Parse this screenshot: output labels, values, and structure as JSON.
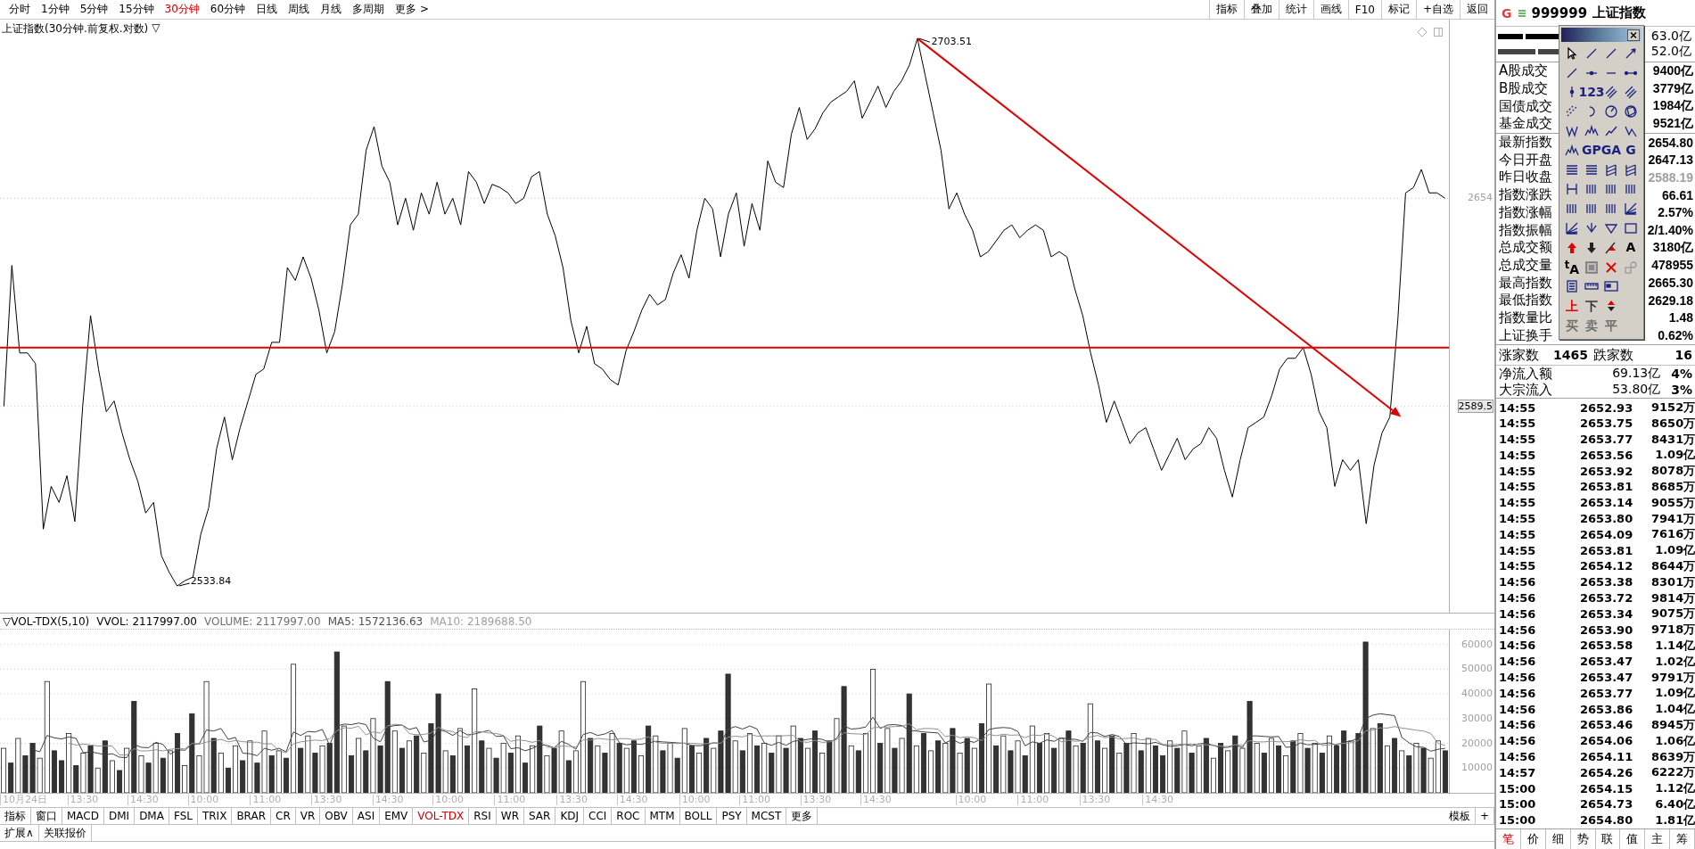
{
  "toolbar": {
    "periods": [
      {
        "label": "分时",
        "selected": false
      },
      {
        "label": "1分钟",
        "selected": false
      },
      {
        "label": "5分钟",
        "selected": false
      },
      {
        "label": "15分钟",
        "selected": false
      },
      {
        "label": "30分钟",
        "selected": true
      },
      {
        "label": "60分钟",
        "selected": false
      },
      {
        "label": "日线",
        "selected": false
      },
      {
        "label": "周线",
        "selected": false
      },
      {
        "label": "月线",
        "selected": false
      },
      {
        "label": "多周期",
        "selected": false
      },
      {
        "label": "更多 >",
        "selected": false
      }
    ],
    "buttons": [
      "指标",
      "叠加",
      "统计",
      "画线",
      "F10",
      "标记",
      "+自选",
      "返回"
    ]
  },
  "main_chart": {
    "title": "上证指数(30分钟.前复权.对数)",
    "title_menu": "▽",
    "high_label": "2703.51",
    "low_label": "2533.84",
    "chart_data": {
      "type": "line",
      "grid": true,
      "ylim": [
        2525.6,
        2709.3
      ],
      "categories": [
        null,
        null,
        null,
        null,
        null,
        null,
        null,
        null,
        null,
        null,
        null,
        null,
        null,
        null,
        null,
        null,
        null,
        null,
        null,
        null,
        null,
        null,
        null,
        null,
        null,
        null,
        null,
        null,
        null,
        null,
        null,
        null,
        null,
        null,
        null,
        null,
        null,
        null,
        null,
        null,
        null,
        null,
        null,
        null,
        null,
        null,
        null,
        null,
        null,
        null,
        null,
        null,
        null,
        null,
        null,
        null,
        null,
        null,
        null,
        null,
        null,
        null,
        null,
        null,
        null,
        null,
        null,
        null,
        null,
        null,
        null,
        null,
        null,
        null,
        null,
        null,
        null,
        null,
        null,
        null,
        null,
        null,
        null,
        null,
        null,
        null,
        null,
        null,
        null,
        null,
        null,
        null,
        null,
        null,
        null,
        null,
        null,
        null,
        null,
        null,
        null,
        null,
        null,
        null,
        null,
        null,
        null,
        null,
        null,
        null,
        null,
        null,
        null,
        null,
        null,
        null,
        null,
        null,
        null,
        null,
        null,
        null,
        null,
        null,
        null,
        null,
        null,
        null,
        null,
        null,
        null,
        null,
        null,
        null,
        null,
        null,
        null,
        null,
        null,
        null,
        null,
        null,
        null,
        null,
        null,
        null,
        null,
        null,
        null,
        null,
        null,
        null,
        null,
        null,
        null,
        null,
        null,
        null,
        null,
        null,
        null,
        null,
        null,
        null,
        null,
        null,
        null,
        null,
        null,
        null,
        null,
        null,
        null,
        null,
        null,
        null,
        null,
        null,
        null,
        null,
        null,
        null,
        null,
        null
      ],
      "yticks": [
        {
          "value": 2654,
          "label": "2654"
        },
        {
          "value": 2589.5,
          "label": "2589.5"
        }
      ],
      "series": [
        {
          "color": "#000000",
          "values": [
            2589.5,
            2633.16,
            2606.04,
            2606.04,
            2602.73,
            2551.45,
            2564.69,
            2559.72,
            2567.99,
            2553.77,
            2589.5,
            2617.61,
            2601.07,
            2587.84,
            2591.15,
            2581.23,
            2572.96,
            2566.34,
            2556.42,
            2559.72,
            2543.18,
            2538.0,
            2533.84,
            2535.5,
            2536.57,
            2549.8,
            2558.07,
            2576.26,
            2586.19,
            2572.96,
            2582.88,
            2591.15,
            2599.42,
            2601.07,
            2609.34,
            2609.34,
            2632.5,
            2628.53,
            2635.81,
            2629.19,
            2619.27,
            2606.04,
            2612.65,
            2627.54,
            2645.73,
            2649.04,
            2668.89,
            2676.17,
            2663.93,
            2658.96,
            2645.73,
            2654.0,
            2644.08,
            2655.66,
            2649.04,
            2658.96,
            2649.04,
            2654.0,
            2645.73,
            2662.27,
            2658.96,
            2652.35,
            2658.3,
            2657.31,
            2655.66,
            2652.35,
            2654.0,
            2660.62,
            2662.27,
            2649.04,
            2642.42,
            2632.5,
            2615.96,
            2606.04,
            2614.31,
            2602.73,
            2601.07,
            2597.77,
            2596.11,
            2606.7,
            2612.65,
            2619.27,
            2624.23,
            2620.92,
            2622.58,
            2630.85,
            2636.47,
            2629.19,
            2644.08,
            2654.0,
            2650.69,
            2635.81,
            2649.04,
            2655.66,
            2639.12,
            2652.35,
            2644.08,
            2665.58,
            2658.96,
            2657.31,
            2673.85,
            2682.12,
            2672.2,
            2675.5,
            2680.47,
            2683.77,
            2685.43,
            2687.08,
            2690.39,
            2678.81,
            2683.77,
            2688.74,
            2682.12,
            2687.08,
            2690.39,
            2695.35,
            2703.51,
            2692.04,
            2680.47,
            2668.89,
            2650.69,
            2655.66,
            2649.04,
            2644.08,
            2635.81,
            2637.46,
            2640.77,
            2644.08,
            2645.73,
            2641.76,
            2644.08,
            2645.73,
            2644.08,
            2635.81,
            2637.46,
            2635.81,
            2625.88,
            2617.61,
            2606.04,
            2596.11,
            2584.53,
            2591.15,
            2584.53,
            2577.92,
            2581.23,
            2582.88,
            2576.26,
            2569.65,
            2574.61,
            2579.57,
            2572.96,
            2576.26,
            2577.92,
            2582.88,
            2579.57,
            2569.65,
            2561.38,
            2572.96,
            2582.88,
            2584.53,
            2586.19,
            2592.8,
            2601.07,
            2604.38,
            2604.38,
            2607.69,
            2599.42,
            2587.84,
            2582.88,
            2564.69,
            2572.96,
            2569.65,
            2572.96,
            2553.11,
            2571.3,
            2581.23,
            2586.19,
            2615.96,
            2655.66,
            2657.31,
            2662.93,
            2655.66,
            2655.66,
            2654.0
          ]
        }
      ],
      "ref_lines": [
        {
          "axis": "y",
          "value": 2607.7,
          "color": "#e00000"
        }
      ]
    },
    "drawings": [
      {
        "kind": "arrow",
        "color": "#e00000"
      }
    ]
  },
  "time_axis": [
    "10月24日",
    "13:30",
    "14:30",
    "10:00",
    "11:00",
    "13:30",
    "14:30",
    "10:00",
    "11:00",
    "13:30",
    "14:30",
    "10:00",
    "11:00",
    "13:30",
    "14:30",
    "10:00",
    "11:00",
    "13:30",
    "14:30"
  ],
  "volume_panel": {
    "header": [
      {
        "text": "▽VOL-TDX(5,10)",
        "color": "#000000"
      },
      {
        "text": "VVOL: 2117997.00",
        "color": "#000000"
      },
      {
        "text": "VOLUME: 2117997.00",
        "color": "#707070"
      },
      {
        "text": "MA5: 1572136.63",
        "color": "#505050"
      },
      {
        "text": "MA10: 2189688.50",
        "color": "#a0a0a0"
      }
    ],
    "chart_data": {
      "type": "bar",
      "stacked": true,
      "grid": true,
      "ylim": [
        0,
        66000
      ],
      "yticks": [
        10000,
        20000,
        30000,
        40000,
        50000,
        60000
      ],
      "series": [
        {
          "color": "#ffffff",
          "values": [
            18000,
            null,
            22000,
            null,
            null,
            14000,
            45000,
            null,
            null,
            24000,
            null,
            16000,
            null,
            10000,
            null,
            13000,
            null,
            18000,
            null,
            15000,
            null,
            20000,
            null,
            17000,
            null,
            11000,
            null,
            15000,
            45000,
            null,
            16000,
            null,
            19000,
            null,
            21000,
            null,
            25000,
            null,
            17000,
            null,
            52000,
            null,
            23000,
            null,
            19000,
            null,
            null,
            27000,
            null,
            22000,
            null,
            30000,
            null,
            null,
            25000,
            null,
            21000,
            null,
            16000,
            null,
            null,
            17000,
            null,
            26000,
            null,
            42000,
            null,
            18000,
            null,
            20000,
            null,
            23000,
            null,
            19000,
            null,
            15000,
            null,
            25000,
            null,
            17000,
            45000,
            null,
            19000,
            null,
            24000,
            null,
            18000,
            null,
            15000,
            null,
            23000,
            null,
            20000,
            null,
            26000,
            null,
            16000,
            null,
            18000,
            null,
            null,
            21000,
            null,
            24000,
            null,
            20000,
            null,
            23000,
            null,
            27000,
            null,
            18000,
            null,
            16000,
            null,
            30000,
            null,
            19000,
            null,
            24000,
            50000,
            null,
            26000,
            null,
            22000,
            null,
            19000,
            null,
            17000,
            null,
            20000,
            null,
            16000,
            null,
            18000,
            null,
            44000,
            null,
            23000,
            null,
            21000,
            null,
            27000,
            null,
            24000,
            null,
            22000,
            null,
            19000,
            null,
            36000,
            null,
            18000,
            null,
            16000,
            null,
            24000,
            null,
            22000,
            null,
            null,
            21000,
            null,
            25000,
            null,
            19000,
            null,
            14000,
            null,
            17000,
            null,
            18000,
            null,
            20000,
            null,
            22000,
            null,
            15000,
            null,
            24000,
            null,
            20000,
            null,
            23000,
            null,
            null,
            21000,
            null,
            null,
            26000,
            null,
            19000,
            null,
            17000,
            null,
            20000,
            null,
            14000,
            21000,
            null
          ]
        },
        {
          "color": "#333333",
          "values": [
            null,
            12000,
            null,
            15000,
            20000,
            null,
            null,
            17000,
            13000,
            null,
            11000,
            null,
            19000,
            null,
            21000,
            null,
            9000,
            null,
            37000,
            null,
            12000,
            null,
            14000,
            null,
            24000,
            null,
            32000,
            null,
            null,
            22000,
            null,
            10000,
            null,
            13000,
            null,
            12000,
            null,
            15000,
            null,
            14000,
            null,
            18000,
            null,
            16000,
            null,
            20000,
            57000,
            null,
            15000,
            null,
            17000,
            null,
            19000,
            45000,
            null,
            18000,
            null,
            23000,
            null,
            28000,
            40000,
            null,
            15000,
            null,
            19000,
            null,
            21000,
            null,
            14000,
            null,
            16000,
            null,
            12000,
            null,
            27000,
            null,
            18000,
            null,
            13000,
            null,
            null,
            22000,
            null,
            16000,
            null,
            20000,
            null,
            21000,
            null,
            27000,
            null,
            17000,
            null,
            14000,
            null,
            19000,
            null,
            22000,
            null,
            25000,
            48000,
            null,
            17000,
            null,
            19000,
            null,
            16000,
            null,
            18000,
            null,
            22000,
            null,
            25000,
            null,
            21000,
            null,
            43000,
            null,
            17000,
            null,
            null,
            20000,
            null,
            18000,
            null,
            40000,
            null,
            24000,
            null,
            21000,
            null,
            26000,
            null,
            22000,
            null,
            28000,
            null,
            19000,
            null,
            17000,
            null,
            15000,
            null,
            20000,
            null,
            18000,
            null,
            25000,
            null,
            20000,
            null,
            21000,
            null,
            23000,
            null,
            20000,
            null,
            17000,
            null,
            19000,
            15000,
            null,
            18000,
            null,
            16000,
            null,
            22000,
            null,
            20000,
            null,
            23000,
            null,
            37000,
            null,
            16000,
            null,
            19000,
            null,
            21000,
            null,
            18000,
            null,
            16000,
            null,
            19000,
            25000,
            null,
            24000,
            61000,
            null,
            28000,
            null,
            22000,
            null,
            15000,
            null,
            18000,
            null,
            null,
            17000
          ]
        },
        {
          "type": "line",
          "color": "#404040",
          "values": [
            null,
            null,
            null,
            null,
            17400,
            16600,
            23200,
            22200,
            21800,
            22600,
            22000,
            16200,
            16600,
            16000,
            15400,
            15800,
            14400,
            14200,
            19600,
            18400,
            18200,
            20400,
            19600,
            15600,
            17400,
            17200,
            19600,
            19800,
            25400,
            25000,
            26000,
            21600,
            22400,
            16000,
            15800,
            15000,
            18000,
            17200,
            18000,
            16600,
            24600,
            23200,
            24800,
            24600,
            25600,
            19200,
            27000,
            27800,
            27600,
            28200,
            27600,
            22200,
            20600,
            26600,
            27200,
            27400,
            25600,
            26400,
            20600,
            21200,
            25600,
            24800,
            23200,
            25200,
            23400,
            23800,
            24600,
            25200,
            22800,
            23000,
            17800,
            18200,
            17000,
            18000,
            19400,
            19200,
            18200,
            20800,
            19600,
            17600,
            23600,
            24400,
            23200,
            23800,
            25200,
            20200,
            19400,
            19800,
            19600,
            20200,
            20800,
            20600,
            20400,
            20200,
            20000,
            19200,
            19000,
            19400,
            20200,
            20000,
            25800,
            26800,
            25800,
            27000,
            25800,
            20200,
            19200,
            20400,
            19200,
            20800,
            21200,
            21600,
            22000,
            21600,
            20400,
            22000,
            27000,
            25800,
            26000,
            26600,
            30600,
            26000,
            27400,
            27600,
            27200,
            25200,
            25000,
            24600,
            24400,
            24200,
            20200,
            21600,
            20000,
            21000,
            20400,
            22000,
            25600,
            26200,
            26400,
            26200,
            24800,
            19000,
            20600,
            20000,
            21400,
            20800,
            22200,
            21800,
            21600,
            20800,
            24400,
            24200,
            22800,
            23600,
            22800,
            19600,
            20200,
            20000,
            19800,
            20400,
            19400,
            18800,
            19000,
            19600,
            19000,
            19800,
            20000,
            19200,
            18200,
            18400,
            19200,
            18400,
            23000,
            23000,
            22800,
            22600,
            22800,
            18400,
            18600,
            20200,
            19400,
            19600,
            19800,
            20200,
            19200,
            20600,
            20800,
            22400,
            30000,
            31400,
            32000,
            31600,
            31200,
            22400,
            20200,
            18600,
            18400,
            16800,
            17600,
            18000
          ]
        },
        {
          "type": "line",
          "color": "#909090",
          "values": [
            null,
            null,
            null,
            null,
            null,
            null,
            null,
            null,
            null,
            20000,
            19300,
            19700,
            19400,
            18900,
            19000,
            18900,
            15300,
            15400,
            17800,
            16900,
            17000,
            17400,
            16900,
            17600,
            17900,
            17700,
            20000,
            19700,
            20500,
            21200,
            21600,
            20600,
            21100,
            20700,
            20400,
            20500,
            19800,
            19800,
            17000,
            16200,
            19800,
            20600,
            21000,
            21300,
            21100,
            21900,
            25100,
            26300,
            26100,
            26900,
            23400,
            24600,
            24200,
            27100,
            27700,
            27500,
            23900,
            23500,
            23600,
            24200,
            26500,
            25200,
            24800,
            22900,
            22300,
            24700,
            24700,
            24200,
            24000,
            23200,
            20800,
            21400,
            21100,
            20400,
            21200,
            18500,
            18200,
            18900,
            18800,
            18500,
            21400,
            21300,
            22000,
            21700,
            21400,
            21900,
            21900,
            21500,
            21700,
            22700,
            20500,
            20000,
            20100,
            19900,
            20100,
            20000,
            19800,
            19900,
            20200,
            20000,
            22500,
            22900,
            22600,
            23600,
            22900,
            23000,
            23000,
            23100,
            23100,
            23300,
            20700,
            20400,
            21200,
            20400,
            20600,
            21600,
            24300,
            23900,
            23800,
            23500,
            26300,
            26500,
            26600,
            26800,
            26900,
            27900,
            25500,
            26000,
            26000,
            25700,
            22700,
            23300,
            22300,
            22700,
            22300,
            21100,
            23600,
            23100,
            23700,
            23300,
            23400,
            22300,
            23400,
            23200,
            23800,
            22800,
            20600,
            21200,
            20800,
            21100,
            22600,
            23200,
            22300,
            22600,
            21800,
            22000,
            22200,
            21400,
            21700,
            21600,
            19500,
            19500,
            19500,
            19700,
            19700,
            19600,
            19400,
            19100,
            18900,
            18700,
            19500,
            19200,
            21100,
            20600,
            20600,
            20900,
            20600,
            20700,
            20800,
            21500,
            21000,
            21200,
            19100,
            19400,
            19700,
            20000,
            20200,
            21100,
            25100,
            25300,
            26300,
            26200,
            26800,
            26200,
            25800,
            25300,
            25000,
            24000,
            20000,
            19100
          ]
        }
      ]
    }
  },
  "indicator_tabs": [
    {
      "label": "指标",
      "selected": false
    },
    {
      "label": "窗口",
      "selected": false
    },
    {
      "label": "MACD",
      "selected": false
    },
    {
      "label": "DMI",
      "selected": false
    },
    {
      "label": "DMA",
      "selected": false
    },
    {
      "label": "FSL",
      "selected": false
    },
    {
      "label": "TRIX",
      "selected": false
    },
    {
      "label": "BRAR",
      "selected": false
    },
    {
      "label": "CR",
      "selected": false
    },
    {
      "label": "VR",
      "selected": false
    },
    {
      "label": "OBV",
      "selected": false
    },
    {
      "label": "ASI",
      "selected": false
    },
    {
      "label": "EMV",
      "selected": false
    },
    {
      "label": "VOL-TDX",
      "selected": true
    },
    {
      "label": "RSI",
      "selected": false
    },
    {
      "label": "WR",
      "selected": false
    },
    {
      "label": "SAR",
      "selected": false
    },
    {
      "label": "KDJ",
      "selected": false
    },
    {
      "label": "CCI",
      "selected": false
    },
    {
      "label": "ROC",
      "selected": false
    },
    {
      "label": "MTM",
      "selected": false
    },
    {
      "label": "BOLL",
      "selected": false
    },
    {
      "label": "PSY",
      "selected": false
    },
    {
      "label": "MCST",
      "selected": false
    },
    {
      "label": "更多",
      "selected": false
    }
  ],
  "indicator_right": [
    "模板",
    "+"
  ],
  "bottom_tabs": [
    "扩展∧",
    "关联报价"
  ],
  "quote_panel": {
    "logo": "G",
    "code": "999999",
    "name": "上证指数",
    "flow_bars": [
      {
        "value": "63.0亿"
      },
      {
        "value": "52.0亿"
      }
    ],
    "market_stats": [
      {
        "label": "A股成交",
        "value": "9400亿"
      },
      {
        "label": "B股成交",
        "value": "3779亿"
      },
      {
        "label": "国债成交",
        "value": "1984亿"
      },
      {
        "label": "基金成交",
        "value": "9521亿"
      }
    ],
    "index_stats": [
      {
        "label": "最新指数",
        "value": "2654.80",
        "color": "#000000"
      },
      {
        "label": "今日开盘",
        "value": "2647.13",
        "color": "#000000"
      },
      {
        "label": "昨日收盘",
        "value": "2588.19",
        "color": "#a0a0a0"
      },
      {
        "label": "指数涨跌",
        "value": "66.61",
        "color": "#000000"
      },
      {
        "label": "指数涨幅",
        "value": "2.57%",
        "color": "#000000"
      },
      {
        "label": "指数振幅",
        "value": "2/1.40%",
        "color": "#000000"
      },
      {
        "label": "总成交额",
        "value": "3180亿",
        "color": "#000000"
      },
      {
        "label": "总成交量",
        "value": "478955",
        "color": "#000000"
      },
      {
        "label": "最高指数",
        "value": "2665.30",
        "color": "#000000"
      },
      {
        "label": "最低指数",
        "value": "2629.18",
        "color": "#000000"
      },
      {
        "label": "指数量比",
        "value": "1.48",
        "color": "#000000"
      },
      {
        "label": "上证换手",
        "value": "0.62%",
        "color": "#000000"
      }
    ],
    "breadth": {
      "up_label": "涨家数",
      "up_count": "1465",
      "down_label": "跌家数",
      "down_count": "16"
    },
    "flows": [
      {
        "label": "净流入额",
        "value": "69.13亿",
        "ratio": "4%"
      },
      {
        "label": "大宗流入",
        "value": "53.80亿",
        "ratio": "3%"
      }
    ],
    "ticks": [
      {
        "time": "14:55",
        "price": "2652.93",
        "volume": "9152万"
      },
      {
        "time": "14:55",
        "price": "2653.75",
        "volume": "8650万"
      },
      {
        "time": "14:55",
        "price": "2653.77",
        "volume": "8431万"
      },
      {
        "time": "14:55",
        "price": "2653.56",
        "volume": "1.09亿"
      },
      {
        "time": "14:55",
        "price": "2653.92",
        "volume": "8078万"
      },
      {
        "time": "14:55",
        "price": "2653.81",
        "volume": "8685万"
      },
      {
        "time": "14:55",
        "price": "2653.14",
        "volume": "9055万"
      },
      {
        "time": "14:55",
        "price": "2653.80",
        "volume": "7941万"
      },
      {
        "time": "14:55",
        "price": "2654.09",
        "volume": "7616万"
      },
      {
        "time": "14:55",
        "price": "2653.81",
        "volume": "1.09亿"
      },
      {
        "time": "14:55",
        "price": "2654.12",
        "volume": "8644万"
      },
      {
        "time": "14:56",
        "price": "2653.38",
        "volume": "8301万"
      },
      {
        "time": "14:56",
        "price": "2653.72",
        "volume": "9814万"
      },
      {
        "time": "14:56",
        "price": "2653.34",
        "volume": "9075万"
      },
      {
        "time": "14:56",
        "price": "2653.90",
        "volume": "9718万"
      },
      {
        "time": "14:56",
        "price": "2653.58",
        "volume": "1.14亿"
      },
      {
        "time": "14:56",
        "price": "2653.47",
        "volume": "1.02亿"
      },
      {
        "time": "14:56",
        "price": "2653.47",
        "volume": "9791万"
      },
      {
        "time": "14:56",
        "price": "2653.77",
        "volume": "1.09亿"
      },
      {
        "time": "14:56",
        "price": "2653.86",
        "volume": "1.04亿"
      },
      {
        "time": "14:56",
        "price": "2653.46",
        "volume": "8945万"
      },
      {
        "time": "14:56",
        "price": "2654.06",
        "volume": "1.06亿"
      },
      {
        "time": "14:56",
        "price": "2654.11",
        "volume": "8639万"
      },
      {
        "time": "14:57",
        "price": "2654.26",
        "volume": "6222万"
      },
      {
        "time": "15:00",
        "price": "2654.15",
        "volume": "1.12亿"
      },
      {
        "time": "15:00",
        "price": "2654.73",
        "volume": "6.40亿"
      },
      {
        "time": "15:00",
        "price": "2654.80",
        "volume": "1.81亿"
      }
    ],
    "tabs": [
      {
        "label": "笔",
        "selected": true
      },
      {
        "label": "价",
        "selected": false
      },
      {
        "label": "细",
        "selected": false
      },
      {
        "label": "势",
        "selected": false
      },
      {
        "label": "联",
        "selected": false
      },
      {
        "label": "值",
        "selected": false
      },
      {
        "label": "主",
        "selected": false
      },
      {
        "label": "筹",
        "selected": false
      }
    ]
  },
  "drawing_palette": {
    "rows": [
      [
        {
          "kind": "pointer"
        },
        {
          "kind": "line"
        },
        {
          "kind": "line"
        },
        {
          "kind": "arrow"
        }
      ],
      [
        {
          "kind": "line"
        },
        {
          "kind": "hdot"
        },
        {
          "kind": "hline"
        },
        {
          "kind": "hdots"
        }
      ],
      [
        {
          "kind": "vdot"
        },
        {
          "kind": "text",
          "label": "123",
          "color": "#1a237e"
        },
        {
          "kind": "parallel"
        },
        {
          "kind": "parallel"
        }
      ],
      [
        {
          "kind": "dashed"
        },
        {
          "kind": "arc"
        },
        {
          "kind": "gauge"
        },
        {
          "kind": "polycircle"
        }
      ],
      [
        {
          "kind": "wave"
        },
        {
          "kind": "peaks"
        },
        {
          "kind": "zigzag"
        },
        {
          "kind": "vee"
        }
      ],
      [
        {
          "kind": "peaks"
        },
        {
          "kind": "text",
          "label": "GP",
          "color": "#1a237e"
        },
        {
          "kind": "text",
          "label": "GA",
          "color": "#1a237e"
        },
        {
          "kind": "text",
          "label": "G",
          "color": "#1a237e"
        }
      ],
      [
        {
          "kind": "levels"
        },
        {
          "kind": "levels"
        },
        {
          "kind": "hatch"
        },
        {
          "kind": "hatch"
        }
      ],
      [
        {
          "kind": "bracket"
        },
        {
          "kind": "bars"
        },
        {
          "kind": "bars"
        },
        {
          "kind": "bars"
        }
      ],
      [
        {
          "kind": "bars"
        },
        {
          "kind": "bars"
        },
        {
          "kind": "bars"
        },
        {
          "kind": "fan"
        }
      ],
      [
        {
          "kind": "fan"
        },
        {
          "kind": "downarrow"
        },
        {
          "kind": "triangle"
        },
        {
          "kind": "rect"
        }
      ],
      [
        {
          "kind": "uparrow"
        },
        {
          "kind": "downsolid"
        },
        {
          "kind": "arrowline"
        },
        {
          "kind": "text",
          "label": "A",
          "color": "#000000"
        }
      ],
      [
        {
          "kind": "text",
          "label": "$^{t}$A",
          "color": "#000000"
        },
        {
          "kind": "square"
        },
        {
          "kind": "cross"
        },
        {
          "kind": "shapes"
        }
      ],
      [
        {
          "kind": "doc"
        },
        {
          "kind": "ruler"
        },
        {
          "kind": "card"
        }
      ],
      [
        {
          "kind": "text",
          "label": "上",
          "color": "#e00000"
        },
        {
          "kind": "text",
          "label": "下",
          "color": "#333333"
        },
        {
          "kind": "updown"
        }
      ],
      [
        {
          "kind": "text",
          "label": "买",
          "color": "#707070"
        },
        {
          "kind": "text",
          "label": "卖",
          "color": "#707070"
        },
        {
          "kind": "text",
          "label": "平",
          "color": "#707070"
        }
      ]
    ]
  }
}
